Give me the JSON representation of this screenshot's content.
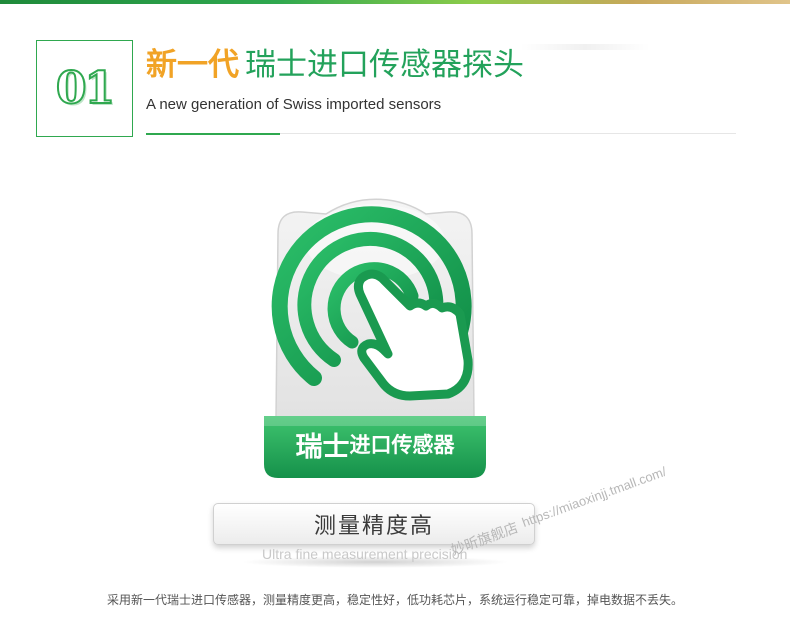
{
  "header": {
    "number": "01",
    "title_accent": "新一代",
    "title_main": "瑞士进口传感器探头",
    "subtitle": "A new generation of Swiss imported sensors"
  },
  "badge": {
    "label_big": "瑞士",
    "label_small": "进口传感器",
    "icon": "fingerprint-touch-icon"
  },
  "feature": {
    "label": "测量精度高",
    "sub_label": "Ultra fine measurement precision"
  },
  "watermark": {
    "url": "https://miaoxinjj.tmall.com/",
    "shop": "妙昕旗舰店"
  },
  "footer": {
    "text": "采用新一代瑞士进口传感器，测量精度更高，稳定性好，低功耗芯片，系统运行稳定可靠，掉电数据不丢失。"
  },
  "colors": {
    "green": "#23a25b",
    "orange": "#f1a326"
  }
}
